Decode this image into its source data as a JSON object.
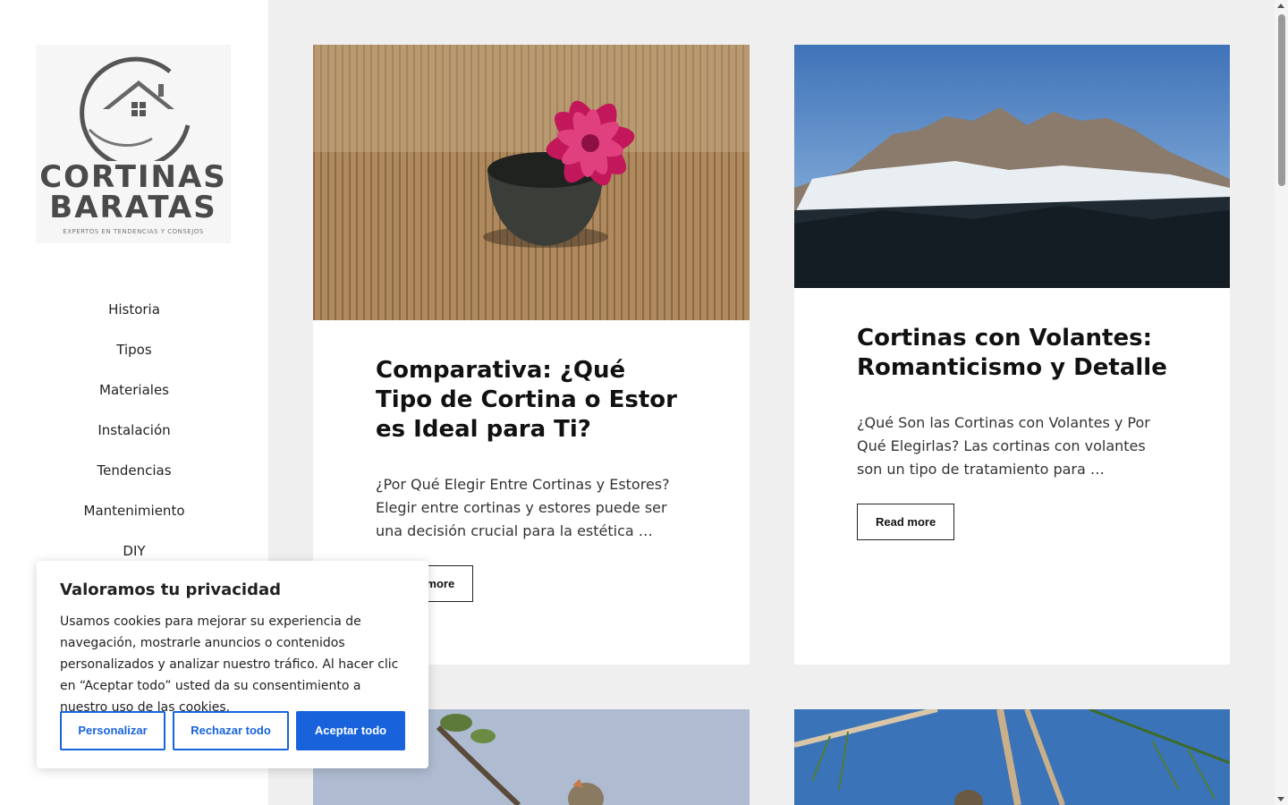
{
  "site": {
    "logo": {
      "line1": "CORTINAS",
      "line2": "BARATAS",
      "tagline": "EXPERTOS EN TENDENCIAS Y CONSEJOS"
    },
    "nav": [
      "Historia",
      "Tipos",
      "Materiales",
      "Instalación",
      "Tendencias",
      "Mantenimiento",
      "DIY"
    ]
  },
  "posts": [
    {
      "title": "Comparativa: ¿Qué Tipo de Cortina o Estor es Ideal para Ti?",
      "excerpt": "¿Por Qué Elegir Entre Cortinas y Estores? Elegir entre cortinas y estores puede ser una decisión crucial para la estética …",
      "read_more": "Read more",
      "image_icon": "pink-flower-bowl-image"
    },
    {
      "title": "Cortinas con Volantes: Romanticismo y Detalle",
      "excerpt": "¿Qué Son las Cortinas con Volantes y Por Qué Elegirlas? Las cortinas con volantes son un tipo de tratamiento para …",
      "read_more": "Read more",
      "image_icon": "mountain-landscape-image"
    },
    {
      "image_icon": "bird-branch-image"
    },
    {
      "image_icon": "bird-pine-image"
    }
  ],
  "cookie": {
    "title": "Valoramos tu privacidad",
    "text": "Usamos cookies para mejorar su experiencia de navegación, mostrarle anuncios o contenidos personalizados y analizar nuestro tráfico. Al hacer clic en “Aceptar todo” usted da su consentimiento a nuestro uso de las cookies.",
    "customize": "Personalizar",
    "reject": "Rechazar todo",
    "accept": "Aceptar todo"
  },
  "colors": {
    "accent": "#1863dc",
    "page_bg": "#efefef",
    "sidebar_bg": "#ffffff"
  }
}
